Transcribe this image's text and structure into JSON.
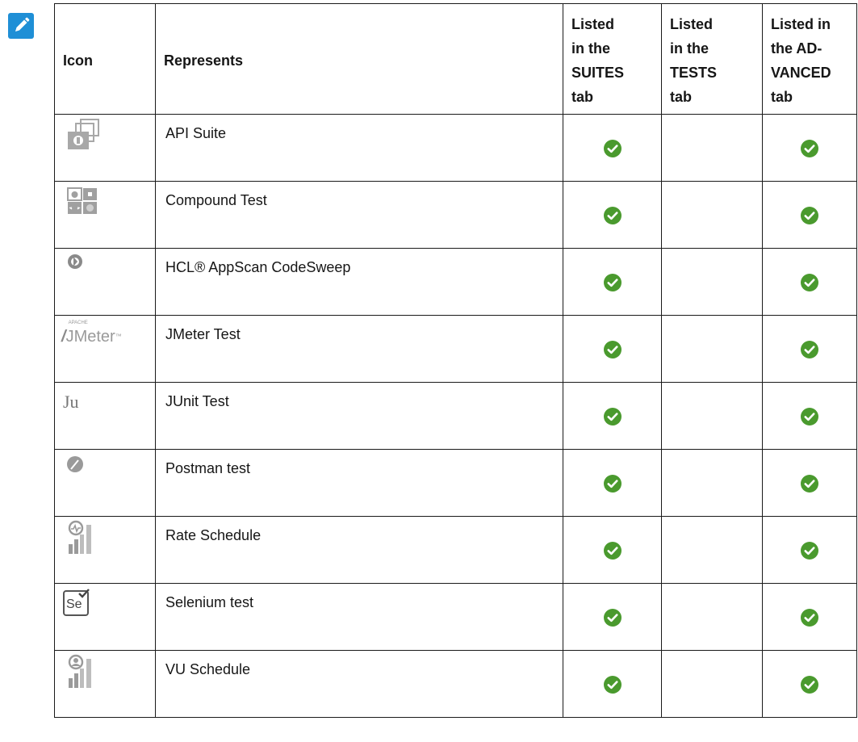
{
  "header": {
    "col_icon": "Icon",
    "col_represents": "Represents",
    "col_suites": [
      "Listed",
      "in the",
      "SUITES",
      "tab"
    ],
    "col_tests": [
      "Listed",
      "in the",
      "TESTS",
      "tab"
    ],
    "col_advanced": [
      "Listed in",
      "the AD-",
      "VANCED",
      "tab"
    ]
  },
  "rows": [
    {
      "icon": "api-suite-icon",
      "represents": "API Suite",
      "suites": true,
      "tests": false,
      "advanced": true
    },
    {
      "icon": "compound-test-icon",
      "represents": "Compound Test",
      "suites": true,
      "tests": false,
      "advanced": true
    },
    {
      "icon": "codesweep-icon",
      "represents": "HCL® AppScan CodeSweep",
      "suites": true,
      "tests": false,
      "advanced": true
    },
    {
      "icon": "jmeter-icon",
      "icon_text": "JMeter",
      "icon_small_text": "APACHE",
      "represents": "JMeter Test",
      "suites": true,
      "tests": false,
      "advanced": true
    },
    {
      "icon": "junit-icon",
      "icon_text": "Ju",
      "represents": "JUnit Test",
      "suites": true,
      "tests": false,
      "advanced": true
    },
    {
      "icon": "postman-icon",
      "represents": "Postman test",
      "suites": true,
      "tests": false,
      "advanced": true
    },
    {
      "icon": "rate-schedule-icon",
      "represents": "Rate Schedule",
      "suites": true,
      "tests": false,
      "advanced": true
    },
    {
      "icon": "selenium-icon",
      "icon_text": "Se",
      "represents": "Selenium test",
      "suites": true,
      "tests": false,
      "advanced": true
    },
    {
      "icon": "vu-schedule-icon",
      "represents": "VU Schedule",
      "suites": true,
      "tests": false,
      "advanced": true
    }
  ],
  "colors": {
    "note_icon": "#1f8fd6",
    "check": "#4a9a2e",
    "icon_gray": "#9a9a9a",
    "border": "#1a1a1a"
  }
}
